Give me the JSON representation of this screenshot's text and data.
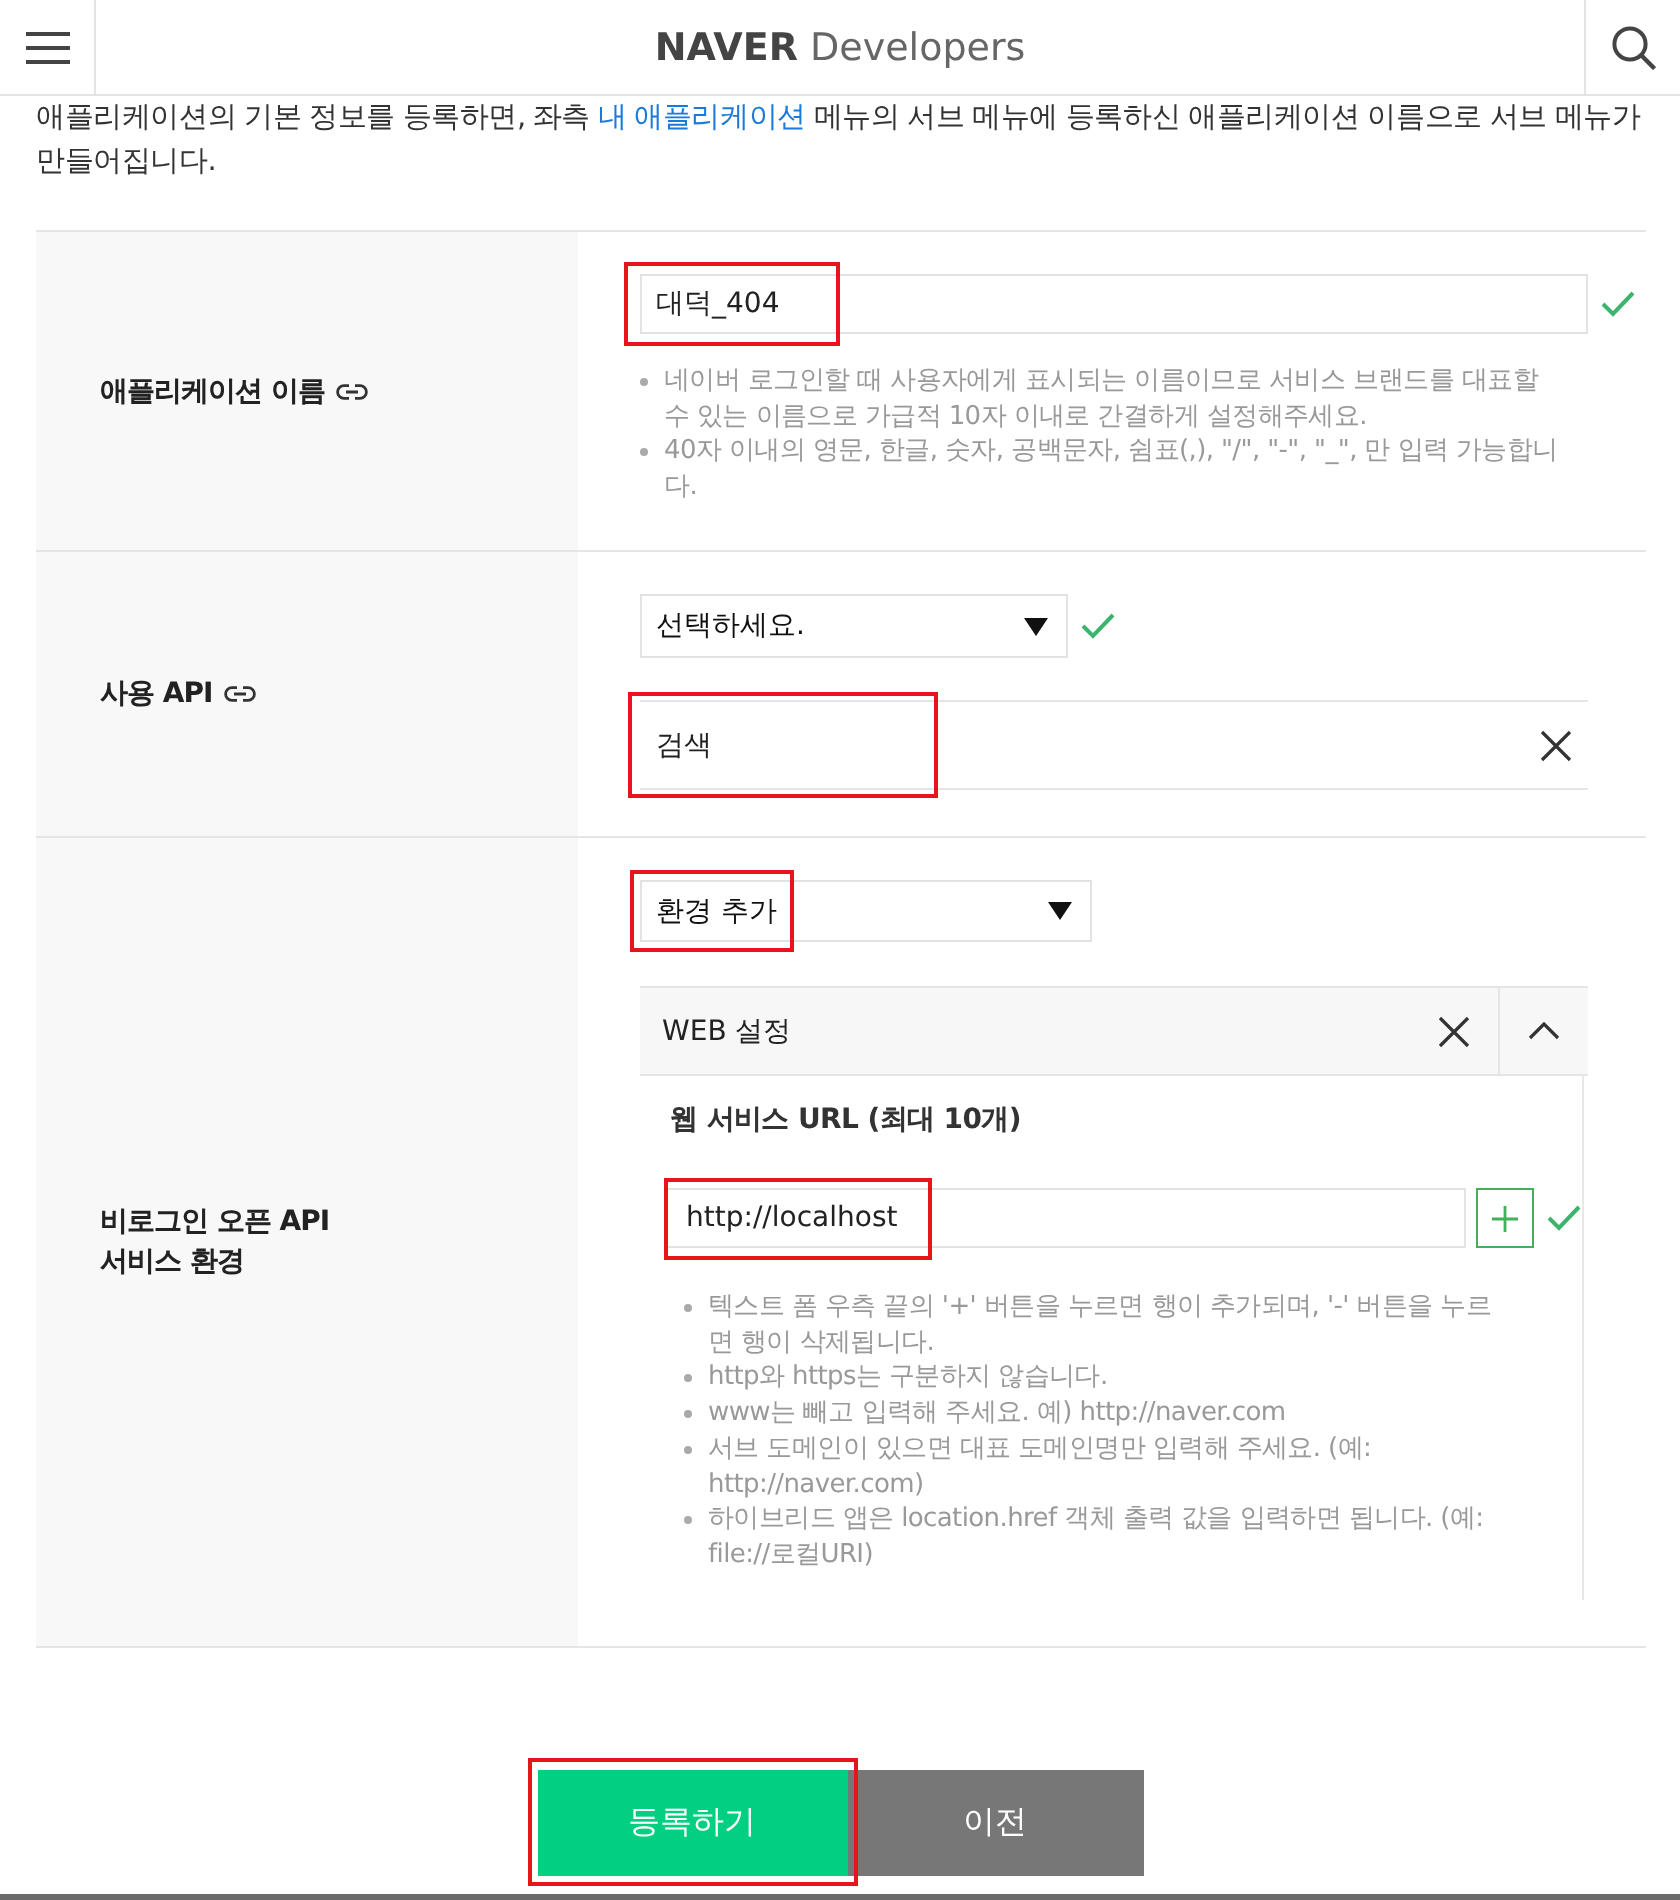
{
  "header": {
    "logo": {
      "brand": "NAVER",
      "product": "Developers"
    }
  },
  "intro": {
    "parts": [
      {
        "kind": "text",
        "text": "애플리케이션의 기본 정보를 등록하면, 좌측 "
      },
      {
        "kind": "link",
        "text": "내 애플리케이션"
      },
      {
        "kind": "text",
        "text": " 메뉴의 서브 메뉴에 등록하신 애플리케이션 이름으로 서브 메뉴가 만들어집니다."
      }
    ]
  },
  "form": {
    "rows": [
      {
        "kind": "name",
        "label": "애플리케이션 이름",
        "link_icon": true,
        "field": {
          "value": "대덕_404",
          "valid": true,
          "highlighted": true
        },
        "help": [
          "네이버 로그인할 때 사용자에게 표시되는 이름이므로 서비스 브랜드를 대표할 수 있는 이름으로 가급적 10자 이내로 간결하게 설정해주세요.",
          "40자 이내의 영문, 한글, 숫자, 공백문자, 쉼표(,), \"/\", \"-\", \"_\", 만 입력 가능합니다."
        ]
      },
      {
        "kind": "api",
        "label": "사용 API",
        "link_icon": true,
        "select": {
          "value": "선택하세요.",
          "valid": true
        },
        "items": [
          {
            "label": "검색",
            "highlighted": true
          }
        ]
      },
      {
        "kind": "environment",
        "label": "비로그인 오픈 API\n서비스 환경",
        "select": {
          "value": "환경 추가",
          "highlighted": true
        },
        "panels": [
          {
            "title": "WEB 설정",
            "expanded": true,
            "url_label": "웹 서비스 URL (최대 10개)",
            "urls": [
              {
                "value": "http://localhost",
                "valid": true,
                "highlighted": true
              }
            ],
            "help": [
              "텍스트 폼 우측 끝의 '+' 버튼을 누르면 행이 추가되며, '-' 버튼을 누르면 행이 삭제됩니다.",
              "http와 https는 구분하지 않습니다.",
              "www는 빼고 입력해 주세요. 예) http://naver.com",
              "서브 도메인이 있으면 대표 도메인명만 입력해 주세요. (예: http://naver.com)",
              "하이브리드 앱은 location.href 객체 출력 값을 입력하면 됩니다. (예: file://로컬URI)"
            ]
          }
        ]
      }
    ]
  },
  "buttons": [
    {
      "label": "등록하기",
      "kind": "primary",
      "highlighted": true
    },
    {
      "label": "이전",
      "kind": "secondary",
      "highlighted": false
    }
  ]
}
